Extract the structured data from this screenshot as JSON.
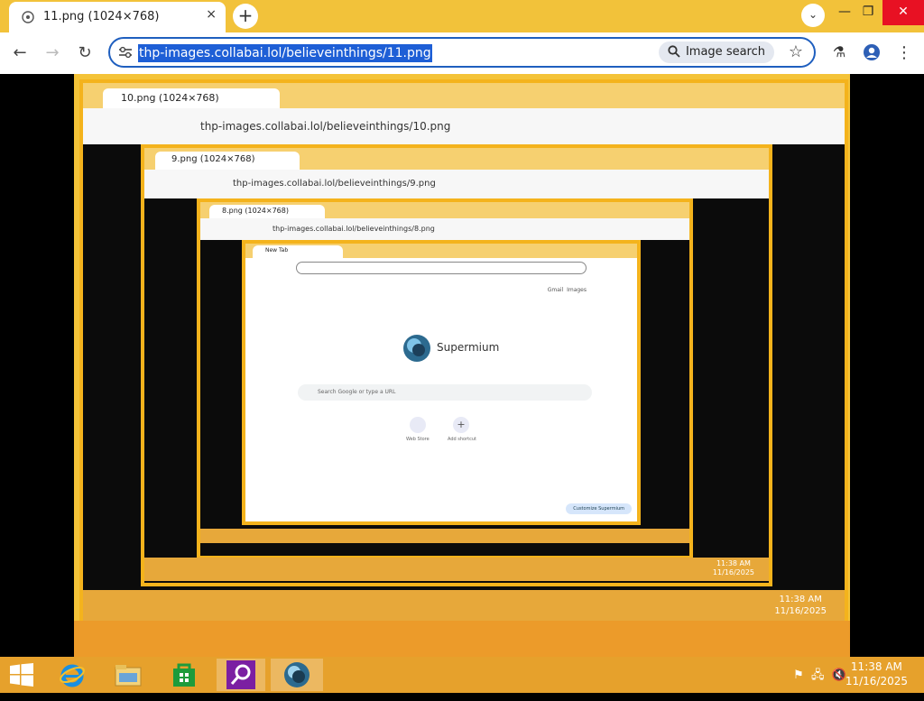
{
  "browser": {
    "tab": {
      "title": "11.png (1024×768)",
      "close": "×"
    },
    "newtab": "+",
    "caption": {
      "minimize": "—",
      "restore": "❐",
      "close": "✕"
    },
    "toolbar": {
      "url": "thp-images.collabai.lol/believeinthings/11.png",
      "image_search_label": "Image search"
    }
  },
  "nested": {
    "level10": {
      "tab_title": "10.png (1024×768)",
      "url": "thp-images.collabai.lol/believeinthings/10.png",
      "time": "11:38 AM",
      "date": "11/16/2025"
    },
    "level9": {
      "tab_title": "9.png (1024×768)",
      "url": "thp-images.collabai.lol/believeinthings/9.png",
      "time": "11:38 AM",
      "date": "11/16/2025"
    },
    "level8": {
      "tab_title": "8.png (1024×768)",
      "url": "thp-images.collabai.lol/believeinthings/8.png"
    },
    "level7": {
      "tab_title": "New Tab",
      "links": [
        "Gmail",
        "Images"
      ],
      "brand": "Supermium",
      "search_placeholder": "Search Google or type a URL",
      "shortcuts": [
        "Web Store",
        "Add shortcut"
      ],
      "customize": "Customize Supermium"
    }
  },
  "taskbar": {
    "time": "11:38 AM",
    "date": "11/16/2025",
    "apps": [
      "start",
      "internet-explorer",
      "file-explorer",
      "store",
      "search-app",
      "supermium"
    ],
    "colors": {
      "bar": "#e6a12c",
      "accent": "#1e5fd6"
    }
  }
}
